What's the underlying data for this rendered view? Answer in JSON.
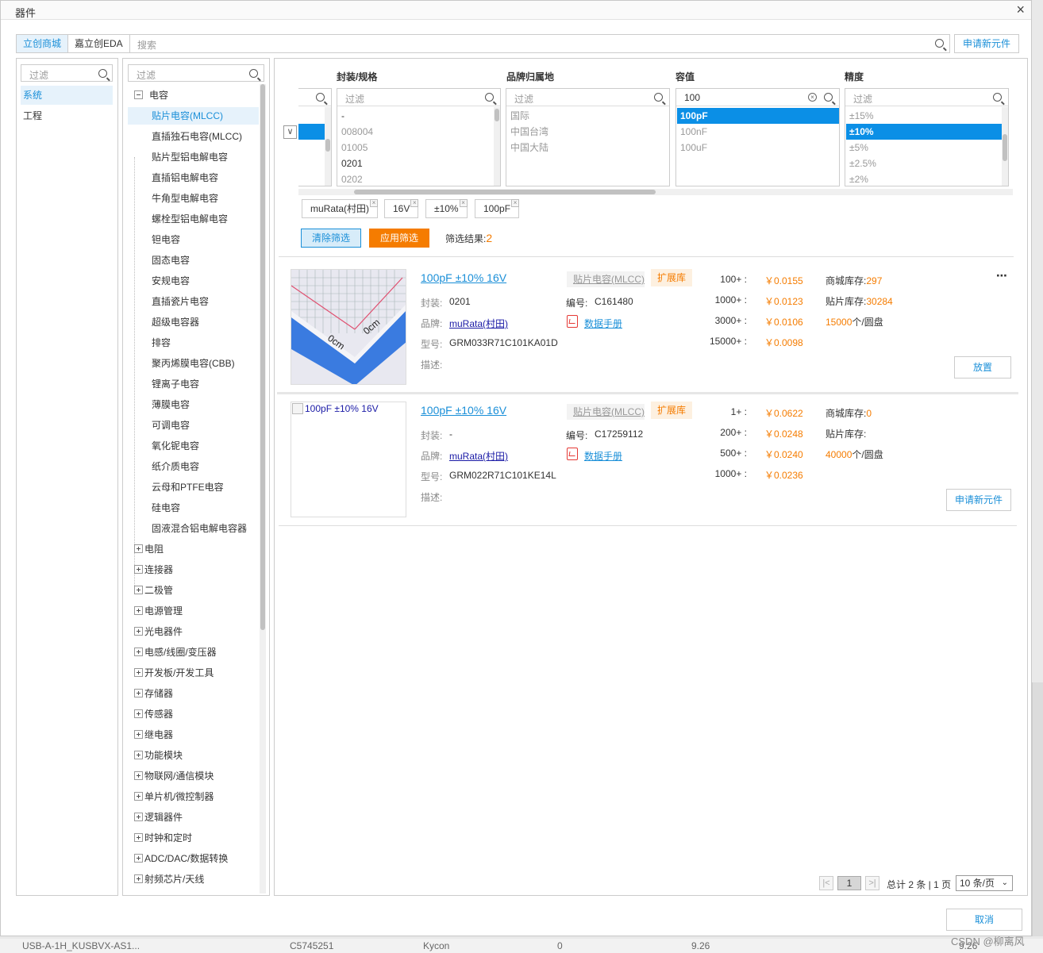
{
  "dialog": {
    "title": "器件",
    "close_icon": "×"
  },
  "topbar": {
    "tabs": [
      "立创商城",
      "嘉立创EDA"
    ],
    "search_placeholder": "搜索",
    "request_button": "申请新元件"
  },
  "library_panel": {
    "filter_placeholder": "过滤",
    "items": [
      "系统",
      "工程"
    ]
  },
  "category_tree": {
    "filter_placeholder": "过滤",
    "root": "电容",
    "children": [
      "贴片电容(MLCC)",
      "直插独石电容(MLCC)",
      "贴片型铝电解电容",
      "直插铝电解电容",
      "牛角型电解电容",
      "螺栓型铝电解电容",
      "钽电容",
      "固态电容",
      "安规电容",
      "直插瓷片电容",
      "超级电容器",
      "排容",
      "聚丙烯膜电容(CBB)",
      "锂离子电容",
      "薄膜电容",
      "可调电容",
      "氧化铌电容",
      "纸介质电容",
      "云母和PTFE电容",
      "硅电容",
      "固液混合铝电解电容器"
    ],
    "others": [
      "电阻",
      "连接器",
      "二极管",
      "电源管理",
      "光电器件",
      "电感/线圈/变压器",
      "开发板/开发工具",
      "存储器",
      "传感器",
      "继电器",
      "功能模块",
      "物联网/通信模块",
      "单片机/微控制器",
      "逻辑器件",
      "时钟和定时",
      "ADC/DAC/数据转换",
      "射频芯片/天线"
    ]
  },
  "filters": {
    "columns": [
      {
        "head": "封装/规格",
        "placeholder": "过滤",
        "value": "",
        "options": [
          "-",
          "008004",
          "01005",
          "0201",
          "0202"
        ],
        "dark": [
          0,
          3
        ],
        "selected": -1
      },
      {
        "head": "品牌归属地",
        "placeholder": "过滤",
        "value": "",
        "options": [
          "国际",
          "中国台湾",
          "中国大陆"
        ],
        "dark": [],
        "selected": -1
      },
      {
        "head": "容值",
        "placeholder": "",
        "value": "100",
        "options": [
          "100pF",
          "100nF",
          "100uF"
        ],
        "dark": [],
        "selected": 0
      },
      {
        "head": "精度",
        "placeholder": "过滤",
        "value": "",
        "options": [
          "±15%",
          "±10%",
          "±5%",
          "±2.5%",
          "±2%"
        ],
        "dark": [],
        "selected": 1
      }
    ],
    "chips": [
      "muRata(村田)",
      "16V",
      "±10%",
      "100pF"
    ],
    "clear_button": "清除筛选",
    "apply_button": "应用筛选",
    "result_label": "筛选结果:",
    "result_count": "2"
  },
  "labels": {
    "package": "封装:",
    "code": "编号:",
    "brand": "品牌:",
    "model": "型号:",
    "desc": "描述:",
    "datasheet": "数据手册",
    "ext_badge": "扩展库",
    "mall_stock": "商城库存:",
    "smt_stock": "贴片库存:"
  },
  "products": [
    {
      "title": "100pF ±10% 16V",
      "category": "贴片电容(MLCC)",
      "package": "0201",
      "code": "C161480",
      "brand": "muRata(村田)",
      "model": "GRM033R71C101KA01D",
      "image_alt": "",
      "prices": [
        {
          "qty": "100+ :",
          "price": "￥0.0155"
        },
        {
          "qty": "1000+ :",
          "price": "￥0.0123"
        },
        {
          "qty": "3000+ :",
          "price": "￥0.0106"
        },
        {
          "qty": "15000+ :",
          "price": "￥0.0098"
        }
      ],
      "mall_stock": "297",
      "smt_stock": "30284",
      "reel_qty": "15000",
      "reel_unit": "个/圆盘",
      "action": "放置"
    },
    {
      "title": "100pF ±10% 16V",
      "category": "贴片电容(MLCC)",
      "package": "-",
      "code": "C17259112",
      "brand": "muRata(村田)",
      "model": "GRM022R71C101KE14L",
      "image_alt": "100pF ±10% 16V",
      "prices": [
        {
          "qty": "1+ :",
          "price": "￥0.0622"
        },
        {
          "qty": "200+ :",
          "price": "￥0.0248"
        },
        {
          "qty": "500+ :",
          "price": "￥0.0240"
        },
        {
          "qty": "1000+ :",
          "price": "￥0.0236"
        }
      ],
      "mall_stock": "0",
      "smt_stock": "",
      "reel_qty": "40000",
      "reel_unit": "个/圆盘",
      "action": "申请新元件"
    }
  ],
  "pager": {
    "current": "1",
    "info": "总计 2 条 | 1 页",
    "page_size": "10 条/页"
  },
  "footer": {
    "cancel_button": "取消"
  },
  "background": {
    "row": [
      "USB-A-1H_KUSBVX-AS1...",
      "C5745251",
      "Kycon",
      "0",
      "9.26",
      "9.26"
    ],
    "watermark": "CSDN @柳离风"
  },
  "colors": {
    "accent": "#1a8fd8",
    "selected": "#0b8fe6",
    "orange": "#f57c00"
  }
}
